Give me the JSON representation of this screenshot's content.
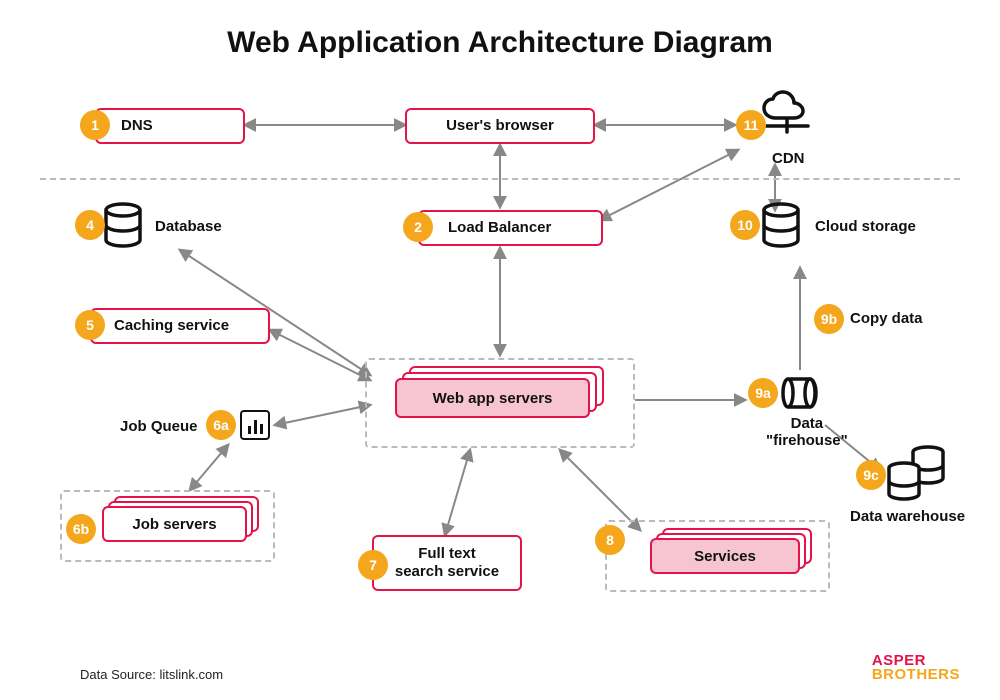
{
  "title": "Web Application Architecture Diagram",
  "nodes": {
    "dns": {
      "num": "1",
      "label": "DNS"
    },
    "browser": {
      "label": "User's browser"
    },
    "cdn": {
      "num": "11",
      "label": "CDN"
    },
    "load_balancer": {
      "num": "2",
      "label": "Load Balancer"
    },
    "database": {
      "num": "4",
      "label": "Database"
    },
    "caching": {
      "num": "5",
      "label": "Caching service"
    },
    "job_queue": {
      "num": "6a",
      "label": "Job Queue"
    },
    "job_servers": {
      "num": "6b",
      "label": "Job servers"
    },
    "full_text": {
      "num": "7",
      "label": "Full text\nsearch service"
    },
    "services": {
      "num": "8",
      "label": "Services"
    },
    "firehouse": {
      "num": "9a",
      "label": "Data\n\"firehouse\""
    },
    "copy_data": {
      "num": "9b",
      "label": "Copy data"
    },
    "warehouse": {
      "num": "9c",
      "label": "Data warehouse"
    },
    "cloud_storage": {
      "num": "10",
      "label": "Cloud storage"
    },
    "web_app": {
      "label": "Web app servers"
    }
  },
  "source": "Data Source: litslink.com",
  "brand": {
    "line1": "ASPER",
    "line2": "BROTHERS"
  }
}
